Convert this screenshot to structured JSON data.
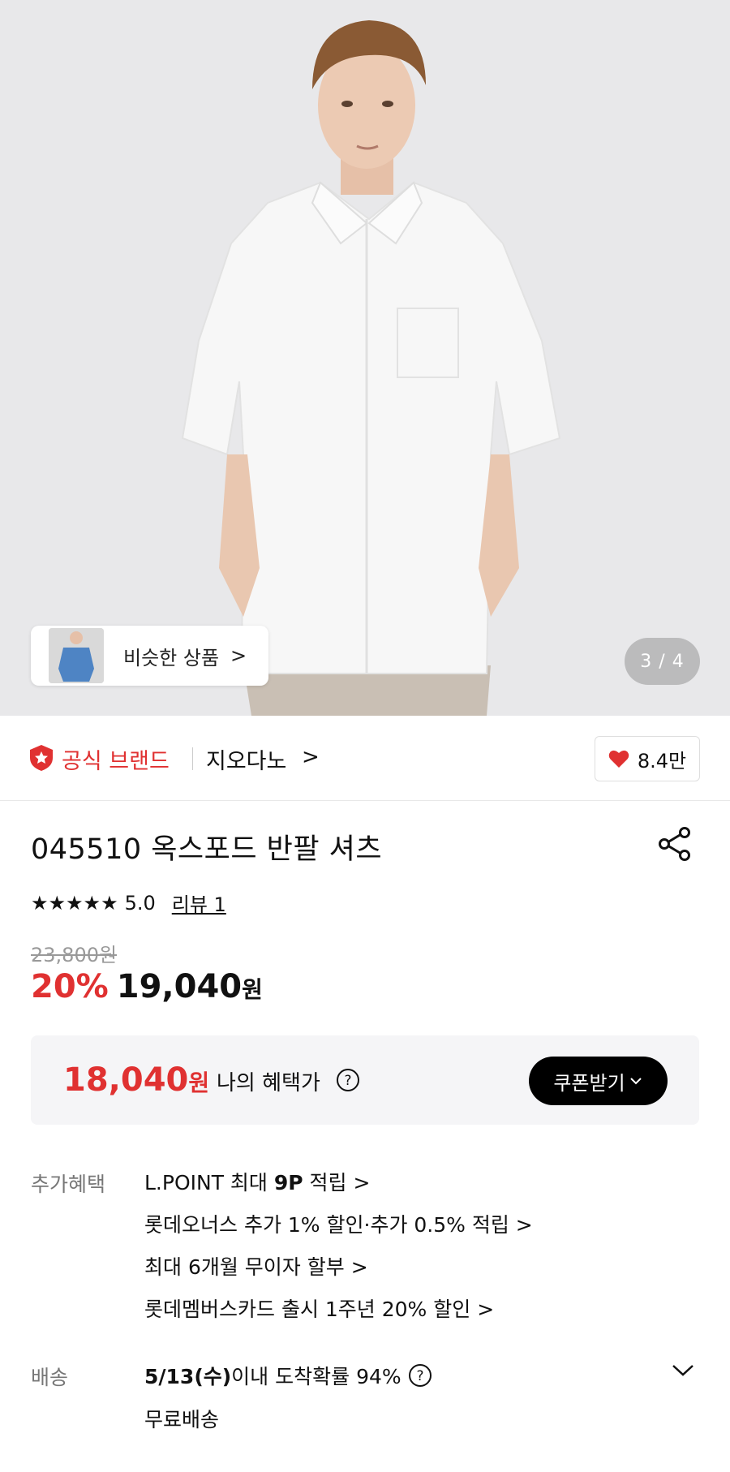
{
  "hero": {
    "image_alt": "model-white-short-sleeve-shirt",
    "similar_label": "비슷한 상품",
    "similar_chevron": ">",
    "page_indicator": "3 / 4"
  },
  "brand": {
    "official_label": "공식 브랜드",
    "name": "지오다노",
    "chevron": ">",
    "like_count": "8.4만"
  },
  "product": {
    "title": "045510 옥스포드 반팔 셔츠",
    "stars": "★★★★★",
    "rating": "5.0",
    "review_link": "리뷰 1",
    "original_price": "23,800원",
    "discount": "20%",
    "sale_price": "19,040",
    "sale_won": "원"
  },
  "benefit": {
    "price": "18,040",
    "won": "원",
    "label": "나의 혜택가",
    "coupon_label": "쿠폰받기"
  },
  "extra_benefits": {
    "title": "추가혜택",
    "items": [
      {
        "pre": "L.POINT 최대 ",
        "bold": "9P",
        "post": " 적립 >"
      },
      {
        "pre": "롯데오너스 추가 1% 할인·추가 0.5% 적립 >",
        "bold": "",
        "post": ""
      },
      {
        "pre": "최대 6개월 무이자 할부 >",
        "bold": "",
        "post": ""
      },
      {
        "pre": "롯데멤버스카드 출시 1주년 20% 할인 >",
        "bold": "",
        "post": ""
      }
    ]
  },
  "delivery": {
    "title": "배송",
    "date": "5/13(수)",
    "text": " 이내 도착확률 94%",
    "free": "무료배송"
  },
  "colors": {
    "accent_red": "#e03131",
    "coupon_bg": "#000000",
    "benefit_box_bg": "#f5f5f7"
  }
}
